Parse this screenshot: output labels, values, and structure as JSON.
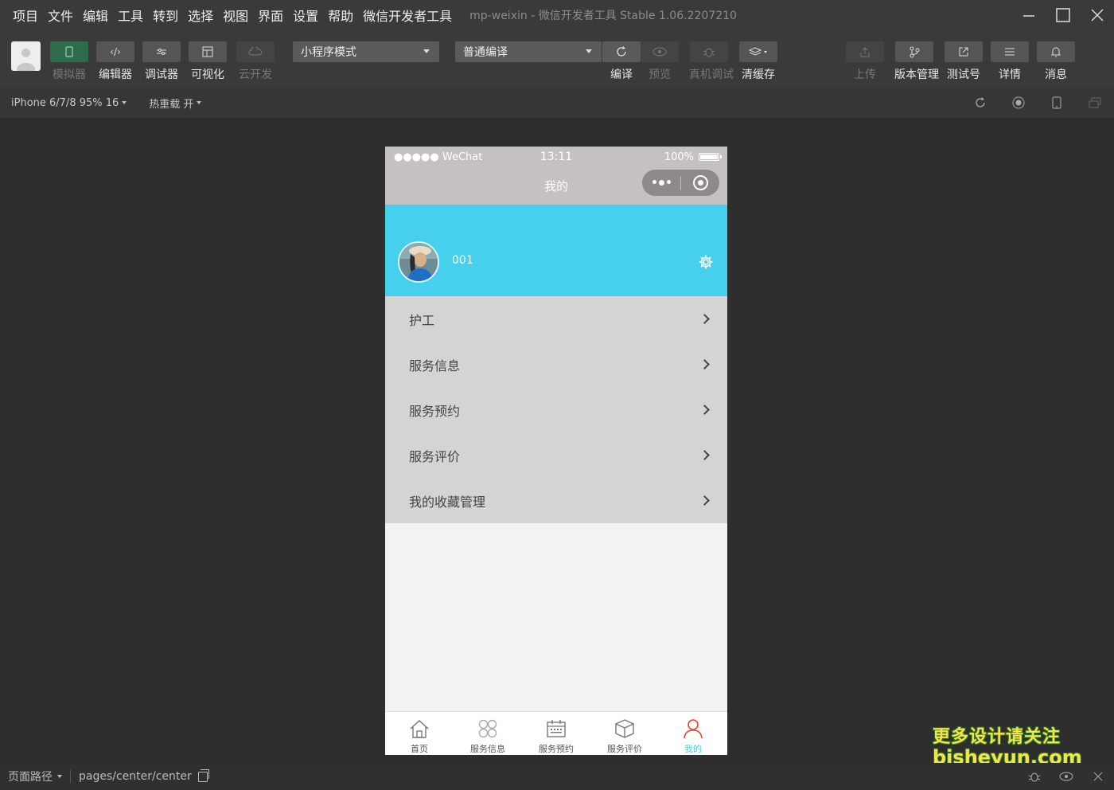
{
  "menu": [
    "项目",
    "文件",
    "编辑",
    "工具",
    "转到",
    "选择",
    "视图",
    "界面",
    "设置",
    "帮助",
    "微信开发者工具"
  ],
  "window_title": "mp-weixin - 微信开发者工具 Stable 1.06.2207210",
  "toolbar": {
    "simulator": "模拟器",
    "editor": "编辑器",
    "debugger": "调试器",
    "visual": "可视化",
    "cloud": "云开发",
    "mode_select": "小程序模式",
    "compile_select": "普通编译",
    "compile": "编译",
    "preview": "预览",
    "remote_debug": "真机调试",
    "clear_cache": "清缓存",
    "upload": "上传",
    "version_mgmt": "版本管理",
    "test_account": "测试号",
    "details": "详情",
    "messages": "消息"
  },
  "subbar": {
    "device": "iPhone 6/7/8 95% 16",
    "hot_reload": "热重载 开"
  },
  "phone": {
    "signal": "●●●●● WeChat",
    "time": "13:11",
    "battery": "100%",
    "nav_title": "我的",
    "username": "001",
    "menu_items": [
      {
        "label": "护工"
      },
      {
        "label": "服务信息"
      },
      {
        "label": "服务预约"
      },
      {
        "label": "服务评价"
      },
      {
        "label": "我的收藏管理"
      }
    ],
    "tabs": [
      {
        "label": "首页",
        "icon": "home-icon"
      },
      {
        "label": "服务信息",
        "icon": "grid-icon"
      },
      {
        "label": "服务预约",
        "icon": "calendar-icon"
      },
      {
        "label": "服务评价",
        "icon": "box-icon"
      },
      {
        "label": "我的",
        "icon": "user-icon",
        "active": true
      }
    ],
    "colors": {
      "header": "#47cfee",
      "nav": "#c5c1c0",
      "list": "#d6d4d3",
      "active_tab": "#47cfee",
      "active_tab_icon": "#e8452f"
    }
  },
  "bottombar": {
    "page_path_label": "页面路径",
    "page_path": "pages/center/center"
  },
  "watermark": {
    "line1": "更多设计请关注",
    "line2": "bisheyun.com"
  }
}
